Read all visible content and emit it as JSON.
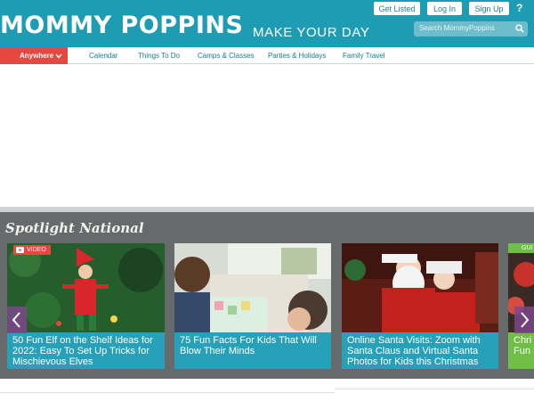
{
  "header": {
    "logo_text": "MOMMY POPPINS",
    "tagline": "MAKE YOUR DAY",
    "buttons": [
      "Get Listed",
      "Log In",
      "Sign Up"
    ],
    "help": "?",
    "search_placeholder": "Search MommyPoppins",
    "search_icon": "magnifier-icon",
    "color": "#1e9cb3"
  },
  "nav": {
    "location": "Anywhere",
    "items": [
      "Calendar",
      "Things To Do",
      "Camps & Classes",
      "Parties & Holidays",
      "Family Travel"
    ],
    "accent": "#e5483f"
  },
  "spotlight": {
    "title": "Spotlight National",
    "cards": [
      {
        "badge": "VIDEO",
        "caption": "50 Fun Elf on the Shelf Ideas for 2022: Easy To Set Up Tricks for Mischievous Elves"
      },
      {
        "caption": "75 Fun Facts For Kids That Will Blow Their Minds"
      },
      {
        "caption": "Online Santa Visits: Zoom with Santa Claus and Virtual Santa Photos for Kids this Christmas"
      },
      {
        "badge": "GUI",
        "caption": "Chri Fun"
      }
    ]
  }
}
